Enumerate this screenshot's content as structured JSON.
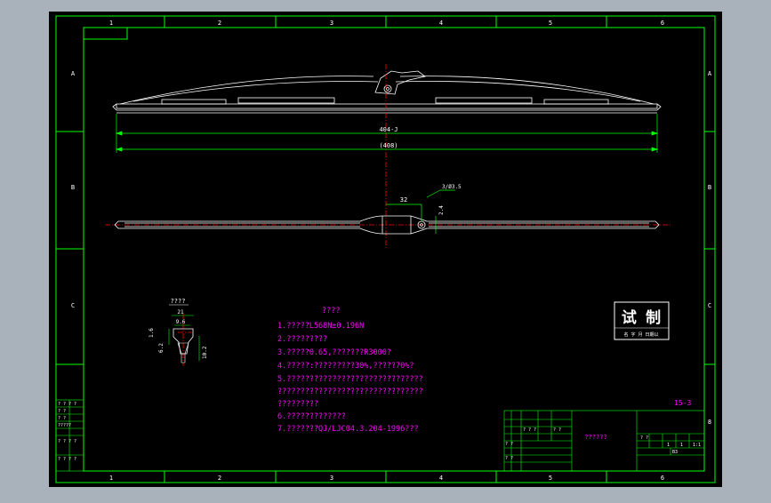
{
  "colors": {
    "background": "#a9b1bb",
    "paper": "#000000",
    "frame": "#00ff00",
    "geometry": "#ffffff",
    "dimension": "#00ff00",
    "centerline": "#ff0000",
    "notes": "#ff00ff",
    "stamp": "#ffffff"
  },
  "frame": {
    "zones_top": [
      "1",
      "2",
      "3",
      "4",
      "5",
      "6"
    ],
    "zones_bottom": [
      "1",
      "2",
      "3",
      "4",
      "5",
      "6"
    ],
    "zones_side": [
      "A",
      "B",
      "C"
    ],
    "zone_right_extra": "8"
  },
  "dimensions": {
    "length_inner": "404-J",
    "length_outer": "(408)",
    "offset": "32",
    "hole": "3/Ø3.5",
    "width": "2.4"
  },
  "detail": {
    "label": "????",
    "top_dim": "21",
    "inner_dim": "9.6",
    "left_dim1": "1.6",
    "left_dim2": "6.2",
    "right_dim": "10.2"
  },
  "notes": {
    "title": "????",
    "lines": [
      "1.?????L568N±0.196N",
      "2.?????????",
      "3.?????0.65,???????R3000?",
      "4.?????:?????????30%,?????70%?",
      "5.??????????????????????????????",
      "????????????????????????????????",
      "?????????",
      "6.?????????????",
      "7.???????QJ/LJC04.3.204-1996???"
    ]
  },
  "stamp": {
    "text": "试 制",
    "sub": "名  字  月  日期以"
  },
  "title_block": {
    "sheet_code": "15-3",
    "name": "??????",
    "left_cells": [
      "? ? ?",
      "? ?",
      "? ?",
      "? ?"
    ],
    "small_r1": "? ?",
    "small_r2": "1",
    "small_r3": "1",
    "small_r4": "1:1",
    "small_r5": "B3"
  },
  "revision_table": {
    "header": "? ? ? ?",
    "rows": [
      "? ?",
      "? ?",
      "?????",
      "? ? ? ?",
      "? ? ? ?"
    ]
  }
}
